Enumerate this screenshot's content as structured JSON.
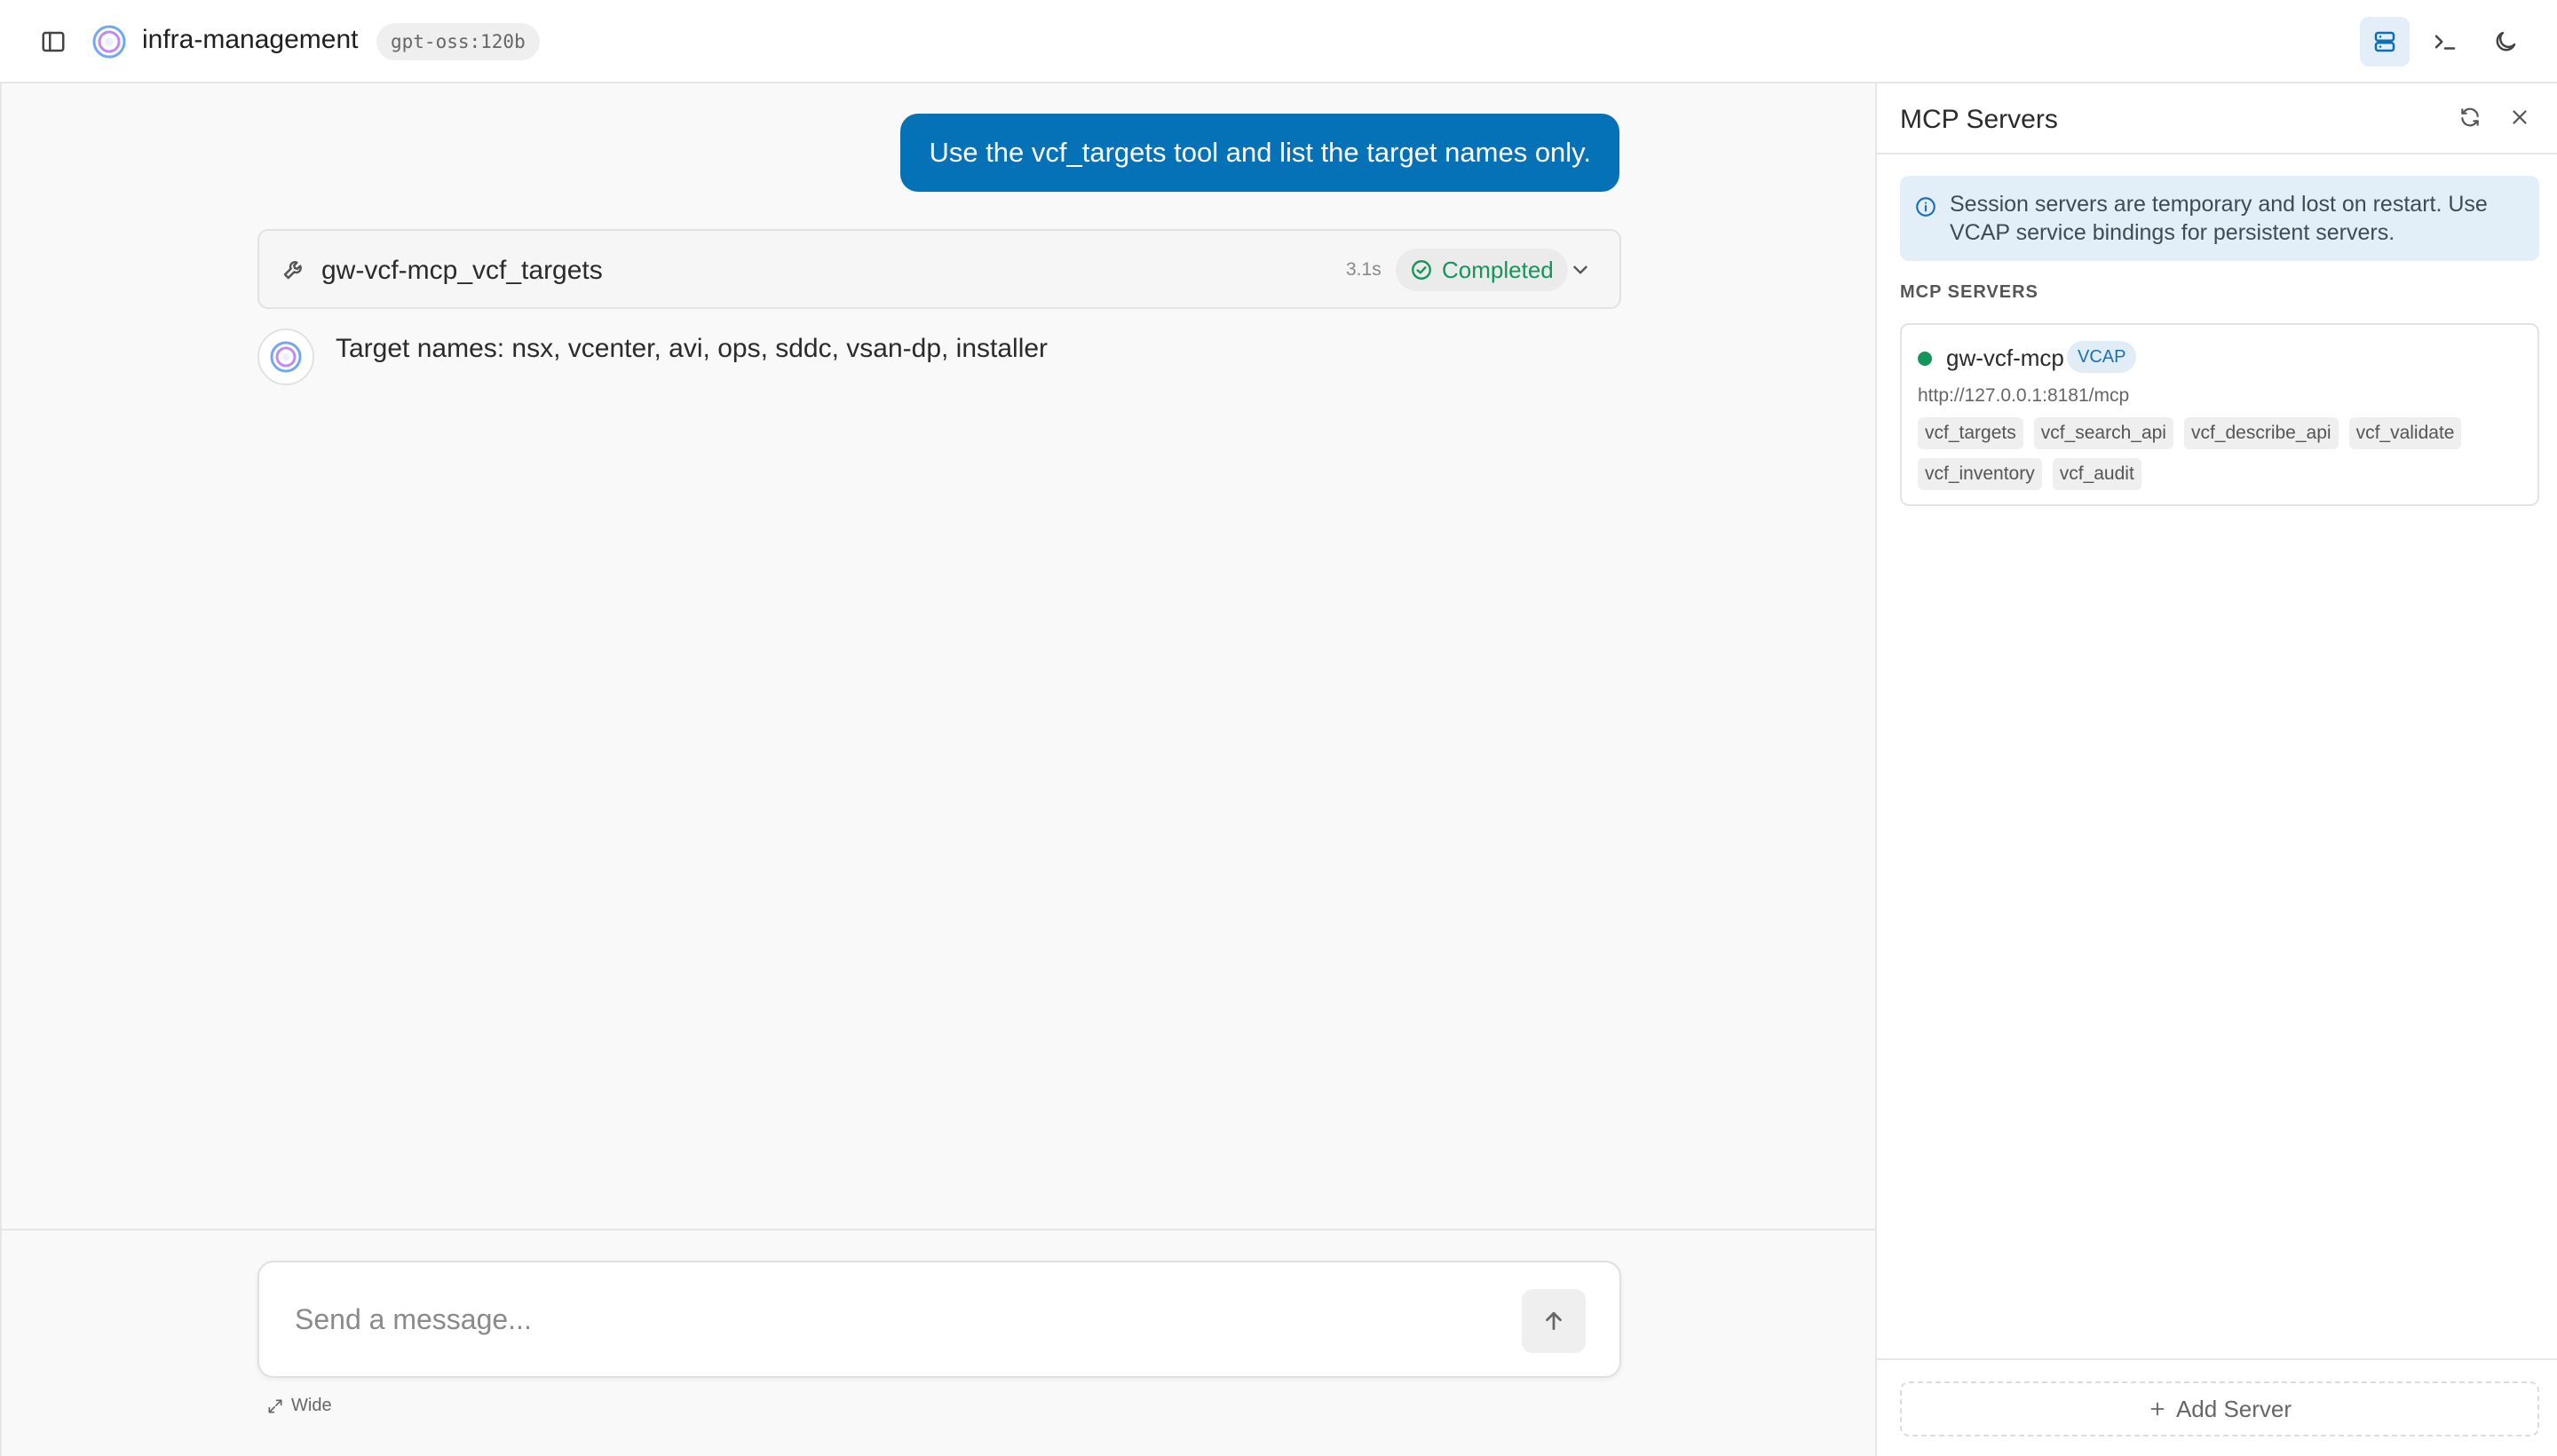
{
  "header": {
    "app_title": "infra-management",
    "model": "gpt-oss:120b",
    "icons": [
      "sidebar-toggle-icon",
      "logo-icon",
      "servers-icon",
      "terminal-icon",
      "moon-icon"
    ]
  },
  "chat": {
    "user_message": "Use the vcf_targets tool and list the target names only.",
    "tool_call": {
      "name": "gw-vcf-mcp_vcf_targets",
      "duration": "3.1s",
      "status": "Completed"
    },
    "assistant_message": "Target names: nsx, vcenter, avi, ops, sddc, vsan-dp, installer"
  },
  "composer": {
    "placeholder": "Send a message...",
    "wide_label": "Wide"
  },
  "panel": {
    "title": "MCP Servers",
    "info": "Session servers are temporary and lost on restart. Use VCAP service bindings for persistent servers.",
    "section_label": "MCP SERVERS",
    "servers": [
      {
        "name": "gw-vcf-mcp",
        "tag": "VCAP",
        "url": "http://127.0.0.1:8181/mcp",
        "status_color": "#14955a",
        "tools": [
          "vcf_targets",
          "vcf_search_api",
          "vcf_describe_api",
          "vcf_validate",
          "vcf_inventory",
          "vcf_audit"
        ]
      }
    ],
    "add_button": "Add Server"
  },
  "colors": {
    "accent": "#0571b6",
    "success": "#14955a",
    "info_bg": "#e3eff8"
  }
}
